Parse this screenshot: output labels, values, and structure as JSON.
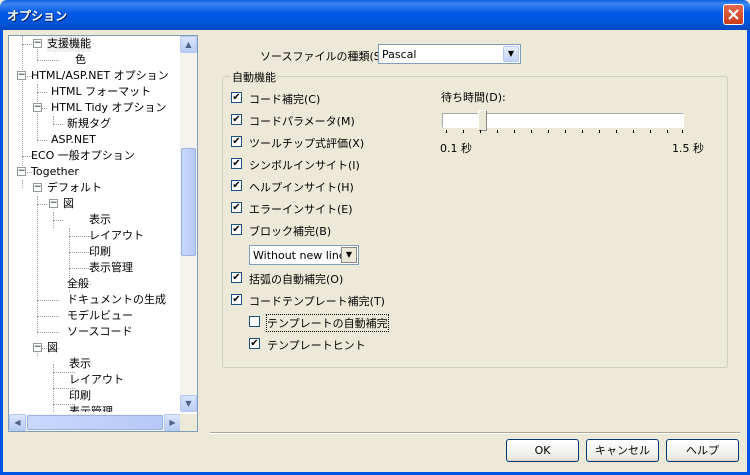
{
  "window": {
    "title": "オプション"
  },
  "tree": {
    "items": [
      {
        "label": "支援機能",
        "selected": true
      },
      {
        "label": "色"
      },
      {
        "label": "HTML/ASP.NET オプション"
      },
      {
        "label": "HTML フォーマット"
      },
      {
        "label": "HTML Tidy オプション"
      },
      {
        "label": "新規タグ"
      },
      {
        "label": "ASP.NET"
      },
      {
        "label": "ECO 一般オプション"
      },
      {
        "label": "Together"
      },
      {
        "label": "デフォルト"
      },
      {
        "label": "図"
      },
      {
        "label": "表示"
      },
      {
        "label": "レイアウト"
      },
      {
        "label": "印刷"
      },
      {
        "label": "表示管理"
      },
      {
        "label": "全般"
      },
      {
        "label": "ドキュメントの生成"
      },
      {
        "label": "モデルビュー"
      },
      {
        "label": "ソースコード"
      },
      {
        "label": "図"
      },
      {
        "label": "表示"
      },
      {
        "label": "レイアウト"
      },
      {
        "label": "印刷"
      },
      {
        "label": "表示管理"
      }
    ]
  },
  "source_type": {
    "label": "ソースファイルの種類(S):",
    "value": "Pascal"
  },
  "auto": {
    "legend": "自動機能",
    "checkboxes": [
      {
        "label": "コード補完(C)",
        "checked": true
      },
      {
        "label": "コードパラメータ(M)",
        "checked": true
      },
      {
        "label": "ツールチップ式評価(X)",
        "checked": true
      },
      {
        "label": "シンボルインサイト(I)",
        "checked": true
      },
      {
        "label": "ヘルプインサイト(H)",
        "checked": true
      },
      {
        "label": "エラーインサイト(E)",
        "checked": true
      },
      {
        "label": "ブロック補完(B)",
        "checked": true
      },
      {
        "label": "括弧の自動補完(O)",
        "checked": true
      },
      {
        "label": "コードテンプレート補完(T)",
        "checked": true
      },
      {
        "label": "テンプレートの自動補完",
        "checked": false
      },
      {
        "label": "テンプレートヒント",
        "checked": true
      }
    ],
    "block_mode": "Without new line",
    "delay": {
      "label": "待ち時間(D):",
      "min_label": "0.1 秒",
      "max_label": "1.5 秒",
      "value_fraction": 0.15
    }
  },
  "buttons": {
    "ok": "OK",
    "cancel": "キャンセル",
    "help": "ヘルプ"
  },
  "check_glyph": "✔"
}
